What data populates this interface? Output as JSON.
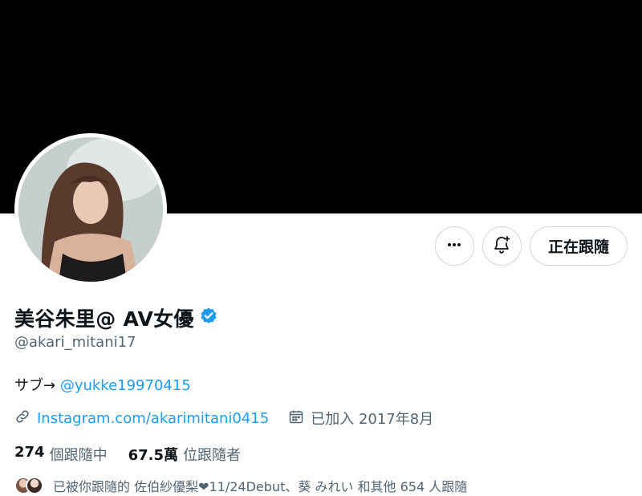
{
  "profile": {
    "display_name": "美谷朱里@ AV女優",
    "handle": "@akari_mitani17",
    "bio_prefix": "サブ→ ",
    "bio_link": "@yukke19970415",
    "website": "Instagram.com/akarimitani0415",
    "joined": "已加入 2017年8月"
  },
  "actions": {
    "more_icon": "more-horizontal-icon",
    "notify_icon": "bell-plus-icon",
    "follow_label": "正在跟隨"
  },
  "stats": {
    "following_count": "274",
    "following_label": "個跟隨中",
    "followers_count": "67.5萬",
    "followers_label": "位跟隨者"
  },
  "followed_by": {
    "text": "已被你跟隨的 佐伯紗優梨❤11/24Debut、葵 みれい 和其他 654 人跟隨"
  },
  "colors": {
    "accent": "#1d9bf0",
    "banner": "#000000",
    "secondary_text": "#536471",
    "verified_badge": "#1d9bf0"
  },
  "icons": {
    "verified": "verified-badge-icon",
    "link": "link-icon",
    "calendar": "calendar-icon"
  }
}
